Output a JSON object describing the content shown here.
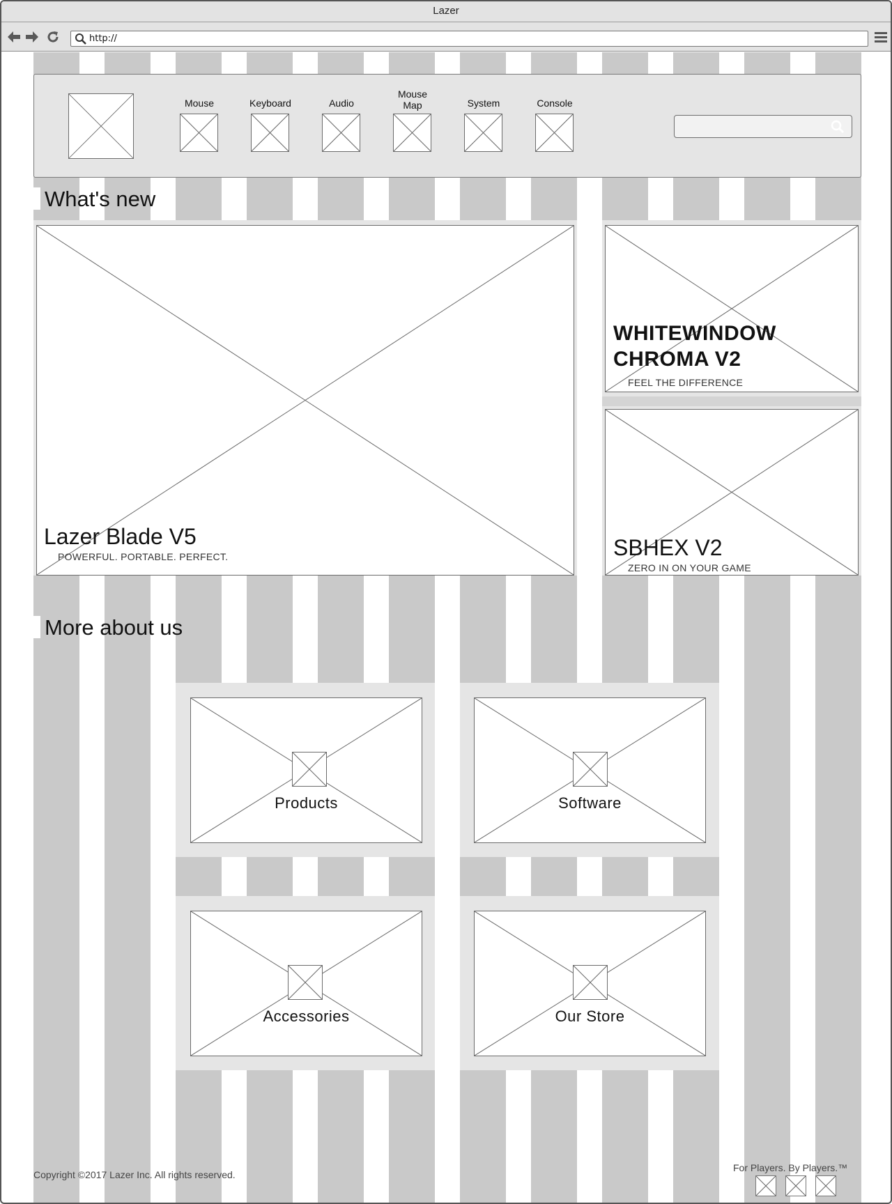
{
  "window": {
    "title": "Lazer"
  },
  "browser": {
    "url": "http://"
  },
  "nav": {
    "items": [
      {
        "label": "Mouse"
      },
      {
        "label": "Keyboard"
      },
      {
        "label": "Audio"
      },
      {
        "label": "Mouse Map"
      },
      {
        "label": "System"
      },
      {
        "label": "Console"
      }
    ],
    "search_placeholder": ""
  },
  "whats_new": {
    "heading": "What's new",
    "main": {
      "title": "Lazer Blade V5",
      "subtitle": "POWERFUL. PORTABLE. PERFECT."
    },
    "side1": {
      "title_line1": "WHITEWINDOW",
      "title_line2": "CHROMA V2",
      "subtitle": "FEEL THE DIFFERENCE"
    },
    "side2": {
      "title": "SBHEX V2",
      "subtitle": "ZERO IN ON YOUR GAME"
    }
  },
  "more": {
    "heading": "More about us",
    "tiles": [
      {
        "label": "Products"
      },
      {
        "label": "Software"
      },
      {
        "label": "Accessories"
      },
      {
        "label": "Our Store"
      }
    ]
  },
  "footer": {
    "copyright": "Copyright ©2017 Lazer Inc. All rights reserved.",
    "tagline": "For Players. By Players.™"
  },
  "icons": {
    "back": "back-arrow-icon",
    "forward": "forward-arrow-icon",
    "reload": "reload-icon",
    "url_search": "search-icon",
    "menu": "hamburger-menu-icon"
  }
}
